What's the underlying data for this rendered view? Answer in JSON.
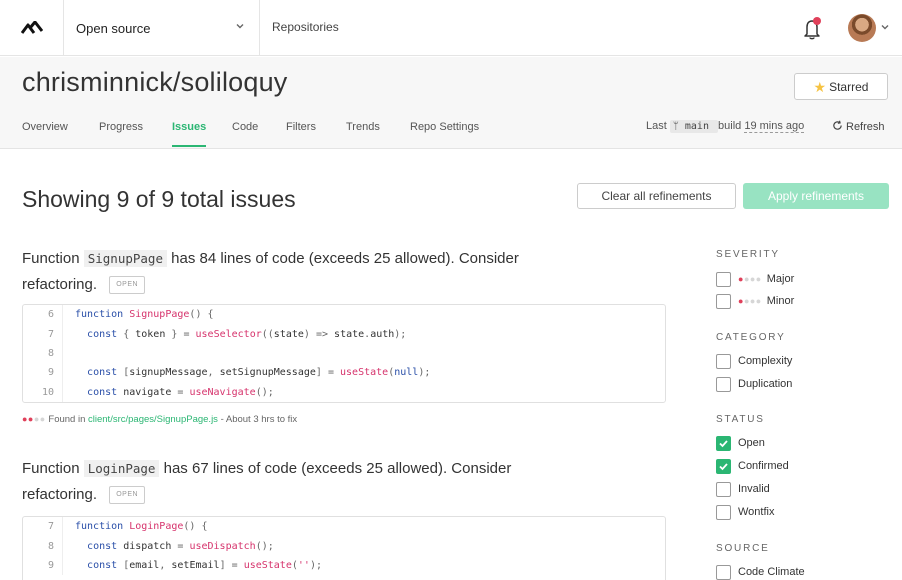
{
  "header": {
    "org": "Open source",
    "repos_link": "Repositories"
  },
  "repo": {
    "title": "chrisminnick/soliloquy",
    "starred_label": "Starred"
  },
  "tabs": [
    "Overview",
    "Progress",
    "Issues",
    "Code",
    "Filters",
    "Trends",
    "Repo Settings"
  ],
  "active_tab": "Issues",
  "build": {
    "prefix": "Last",
    "branch": "main",
    "middle": "build",
    "time": "19 mins ago",
    "refresh": "Refresh"
  },
  "main": {
    "showing": "Showing 9 of 9 total issues",
    "clear_label": "Clear all refinements",
    "apply_label": "Apply refinements"
  },
  "issues": [
    {
      "prefix": "Function",
      "name": "SignupPage",
      "suffix_1": "has 84 lines of code (exceeds 25 allowed). Consider",
      "suffix_2": "refactoring.",
      "status": "OPEN",
      "line_numbers": [
        "6",
        "7",
        "8",
        "9",
        "10"
      ],
      "found_prefix": "Found in",
      "found_path": "client/src/pages/SignupPage.js",
      "found_suffix": "- About 3 hrs to fix"
    },
    {
      "prefix": "Function",
      "name": "LoginPage",
      "suffix_1": "has 67 lines of code (exceeds 25 allowed). Consider",
      "suffix_2": "refactoring.",
      "status": "OPEN",
      "line_numbers": [
        "7",
        "8",
        "9"
      ]
    }
  ],
  "sidebar": {
    "severity": {
      "heading": "SEVERITY",
      "items": [
        {
          "label": "Major",
          "checked": false
        },
        {
          "label": "Minor",
          "checked": false
        }
      ]
    },
    "category": {
      "heading": "CATEGORY",
      "items": [
        {
          "label": "Complexity",
          "checked": false
        },
        {
          "label": "Duplication",
          "checked": false
        }
      ]
    },
    "status": {
      "heading": "STATUS",
      "items": [
        {
          "label": "Open",
          "checked": true
        },
        {
          "label": "Confirmed",
          "checked": true
        },
        {
          "label": "Invalid",
          "checked": false
        },
        {
          "label": "Wontfix",
          "checked": false
        }
      ]
    },
    "source": {
      "heading": "SOURCE",
      "items": [
        {
          "label": "Code Climate",
          "checked": false
        }
      ]
    }
  },
  "colors": {
    "accent": "#2bb673",
    "apply_disabled": "#98e3c2",
    "severity_dot": "#e0405a",
    "star": "#f6c343",
    "notification": "#e0405a"
  },
  "icons": {
    "logo": "codeclimate-logo-icon",
    "bell": "bell-icon",
    "refresh": "refresh-icon",
    "branch": "branch-icon",
    "star": "star-icon",
    "check": "check-icon"
  }
}
